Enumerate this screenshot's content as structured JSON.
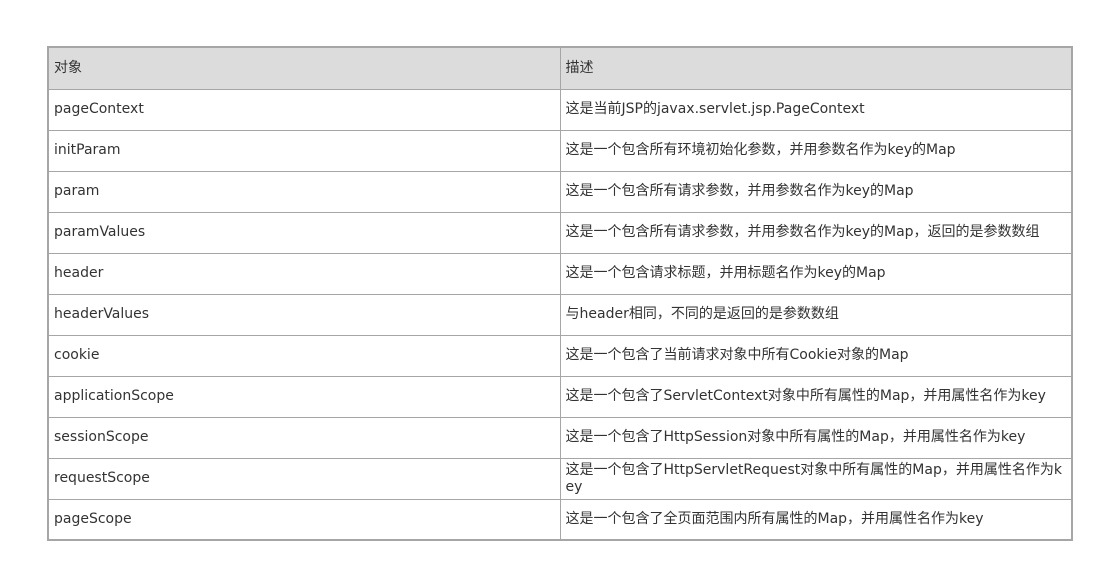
{
  "table": {
    "headers": {
      "object": "对象",
      "description": "描述"
    },
    "rows": [
      {
        "object": "pageContext",
        "description": "这是当前JSP的javax.servlet.jsp.PageContext"
      },
      {
        "object": "initParam",
        "description": "这是一个包含所有环境初始化参数，并用参数名作为key的Map"
      },
      {
        "object": "param",
        "description": "这是一个包含所有请求参数，并用参数名作为key的Map"
      },
      {
        "object": "paramValues",
        "description": "这是一个包含所有请求参数，并用参数名作为key的Map，返回的是参数数组"
      },
      {
        "object": "header",
        "description": "这是一个包含请求标题，并用标题名作为key的Map"
      },
      {
        "object": "headerValues",
        "description": "与header相同，不同的是返回的是参数数组"
      },
      {
        "object": "cookie",
        "description": "这是一个包含了当前请求对象中所有Cookie对象的Map"
      },
      {
        "object": "applicationScope",
        "description": "这是一个包含了ServletContext对象中所有属性的Map，并用属性名作为key"
      },
      {
        "object": "sessionScope",
        "description": "这是一个包含了HttpSession对象中所有属性的Map，并用属性名作为key"
      },
      {
        "object": "requestScope",
        "description": "这是一个包含了HttpServletRequest对象中所有属性的Map，并用属性名作为key"
      },
      {
        "object": "pageScope",
        "description": "这是一个包含了全页面范围内所有属性的Map，并用属性名作为key"
      }
    ]
  }
}
